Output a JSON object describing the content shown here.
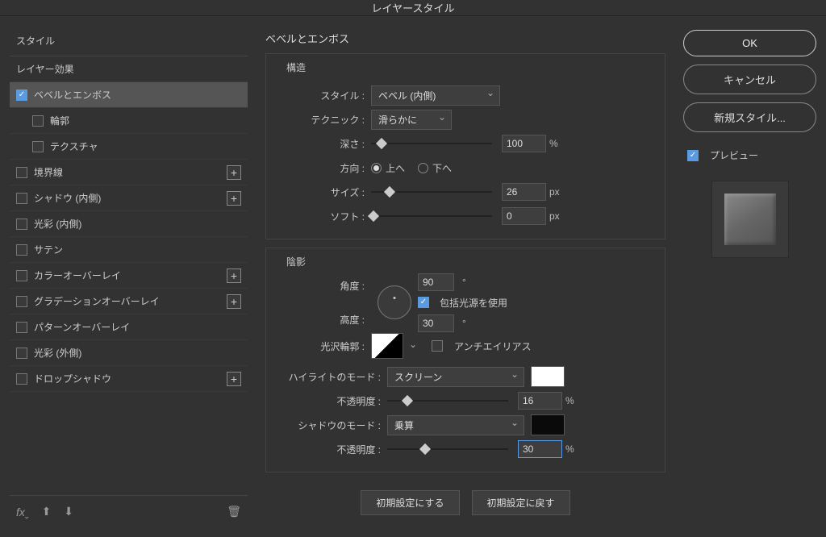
{
  "window": {
    "title": "レイヤースタイル"
  },
  "left": {
    "header": "スタイル",
    "layer_effects": "レイヤー効果",
    "bevel_emboss": "ベベルとエンボス",
    "contour": "輪郭",
    "texture": "テクスチャ",
    "stroke": "境界線",
    "inner_shadow": "シャドウ (内側)",
    "inner_glow": "光彩 (内側)",
    "satin": "サテン",
    "color_overlay": "カラーオーバーレイ",
    "gradient_overlay": "グラデーションオーバーレイ",
    "pattern_overlay": "パターンオーバーレイ",
    "outer_glow": "光彩 (外側)",
    "drop_shadow": "ドロップシャドウ"
  },
  "middle": {
    "panel_title": "ベベルとエンボス",
    "structure": {
      "title": "構造",
      "style_label": "スタイル :",
      "style_value": "ベベル (内側)",
      "technique_label": "テクニック :",
      "technique_value": "滑らかに",
      "depth_label": "深さ :",
      "depth_value": "100",
      "depth_unit": "%",
      "direction_label": "方向 :",
      "direction_up": "上へ",
      "direction_down": "下へ",
      "size_label": "サイズ :",
      "size_value": "26",
      "size_unit": "px",
      "soften_label": "ソフト :",
      "soften_value": "0",
      "soften_unit": "px"
    },
    "shading": {
      "title": "陰影",
      "angle_label": "角度 :",
      "angle_value": "90",
      "angle_unit": "°",
      "use_global": "包括光源を使用",
      "altitude_label": "高度 :",
      "altitude_value": "30",
      "altitude_unit": "°",
      "gloss_contour_label": "光沢輪郭 :",
      "antialias": "アンチエイリアス",
      "highlight_mode_label": "ハイライトのモード :",
      "highlight_mode_value": "スクリーン",
      "highlight_opacity_label": "不透明度 :",
      "highlight_opacity_value": "16",
      "highlight_opacity_unit": "%",
      "shadow_mode_label": "シャドウのモード :",
      "shadow_mode_value": "乗算",
      "shadow_opacity_label": "不透明度 :",
      "shadow_opacity_value": "30",
      "shadow_opacity_unit": "%"
    },
    "make_default": "初期設定にする",
    "reset_default": "初期設定に戻す"
  },
  "right": {
    "ok": "OK",
    "cancel": "キャンセル",
    "new_style": "新規スタイル...",
    "preview": "プレビュー"
  }
}
